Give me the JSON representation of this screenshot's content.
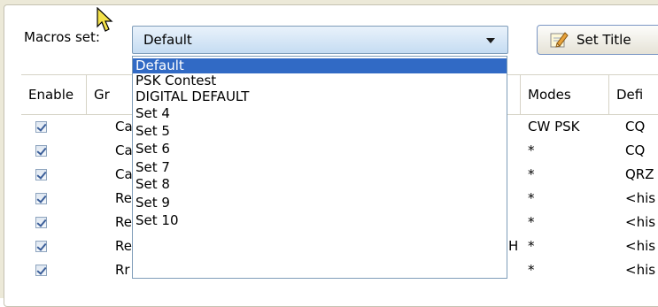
{
  "macros_set": {
    "label": "Macros set:",
    "selected": "Default",
    "options": [
      "Default",
      "PSK Contest",
      "DIGITAL DEFAULT",
      "Set 4",
      "Set 5",
      "Set 6",
      "Set 7",
      "Set 8",
      "Set 9",
      "Set 10"
    ]
  },
  "set_title_button": {
    "label": "Set Title",
    "icon": "pencil-note-icon"
  },
  "table": {
    "columns": [
      "Enable",
      "Gr",
      "Modes",
      "Defi"
    ],
    "rows": [
      {
        "enabled": true,
        "group": "Ca",
        "modes": "CW PSK",
        "def": "CQ"
      },
      {
        "enabled": true,
        "group": "Ca",
        "modes": "*",
        "def": "CQ"
      },
      {
        "enabled": true,
        "group": "Ca",
        "modes": "*",
        "def": "QRZ"
      },
      {
        "enabled": true,
        "group": "Re",
        "modes": "*",
        "def": "<his"
      },
      {
        "enabled": true,
        "group": "Re",
        "modes": "*",
        "def": "<his"
      },
      {
        "enabled": true,
        "group": "Re",
        "extra": "H",
        "modes": "*",
        "def": "<his"
      },
      {
        "enabled": true,
        "group": "Rr",
        "modes": "*",
        "def": "<his"
      }
    ]
  },
  "colors": {
    "selection": "#316ac5",
    "combo_border": "#7f9db9",
    "window_bg": "#ece9d8"
  }
}
